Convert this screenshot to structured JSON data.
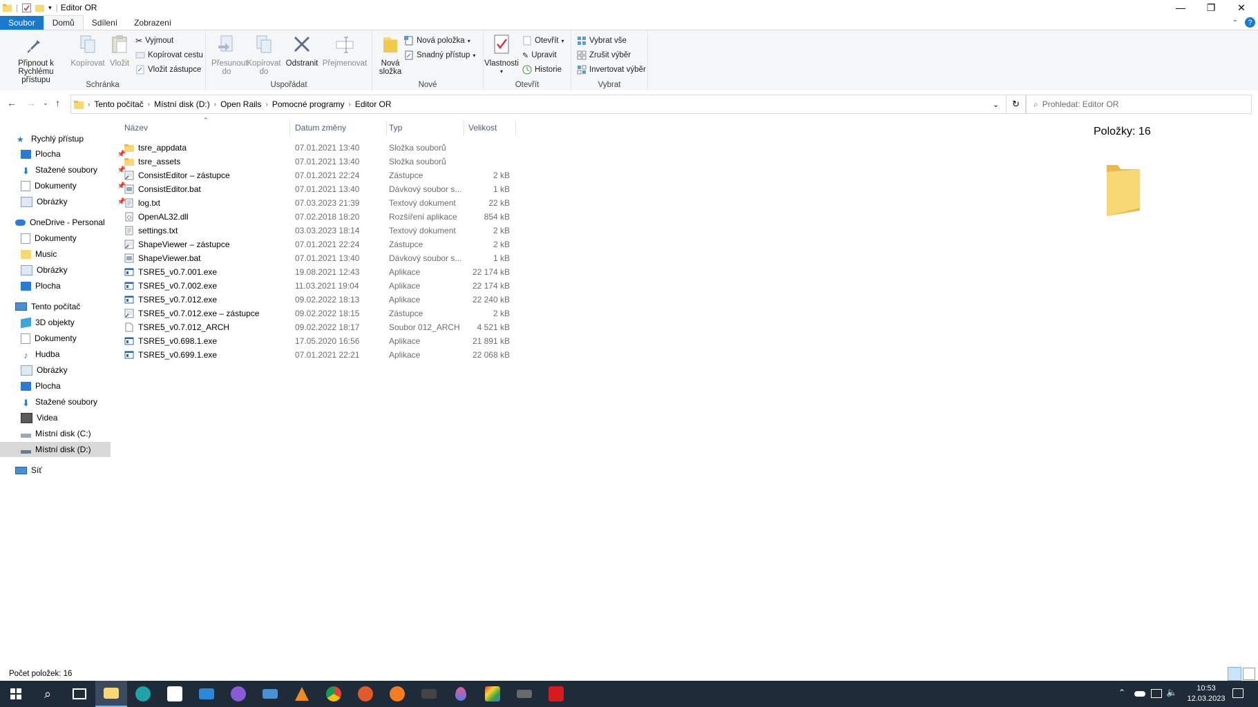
{
  "window": {
    "title": "Editor OR"
  },
  "tabs": [
    "Soubor",
    "Domů",
    "Sdílení",
    "Zobrazení"
  ],
  "ribbon": {
    "pin": "Připnout k Rychlému přístupu",
    "copy": "Kopírovat",
    "paste": "Vložit",
    "cut": "Vyjmout",
    "copy_path": "Kopírovat cestu",
    "paste_shortcut": "Vložit zástupce",
    "clipboard_group": "Schránka",
    "move_to": "Přesunout do",
    "copy_to": "Kopírovat do",
    "delete": "Odstranit",
    "rename": "Přejmenovat",
    "organize_group": "Uspořádat",
    "new_folder": "Nová složka",
    "new_item": "Nová položka",
    "easy_access": "Snadný přístup",
    "new_group": "Nové",
    "properties": "Vlastnosti",
    "open": "Otevřít",
    "edit": "Upravit",
    "history": "Historie",
    "open_group": "Otevřít",
    "select_all": "Vybrat vše",
    "select_none": "Zrušit výběr",
    "invert_selection": "Invertovat výběr",
    "select_group": "Vybrat"
  },
  "breadcrumb": [
    "Tento počítač",
    "Místní disk (D:)",
    "Open Rails",
    "Pomocné programy",
    "Editor OR"
  ],
  "search": {
    "placeholder": "Prohledat: Editor OR"
  },
  "nav": {
    "quick_access": "Rychlý přístup",
    "qa_items": [
      "Plocha",
      "Stažené soubory",
      "Dokumenty",
      "Obrázky"
    ],
    "onedrive": "OneDrive - Personal",
    "od_items": [
      "Dokumenty",
      "Music",
      "Obrázky",
      "Plocha"
    ],
    "this_pc": "Tento počítač",
    "pc_items": [
      "3D objekty",
      "Dokumenty",
      "Hudba",
      "Obrázky",
      "Plocha",
      "Stažené soubory",
      "Videa",
      "Místní disk (C:)",
      "Místní disk (D:)"
    ],
    "network": "Síť"
  },
  "columns": {
    "name": "Název",
    "date": "Datum změny",
    "type": "Typ",
    "size": "Velikost"
  },
  "files": [
    {
      "name": "tsre_appdata",
      "date": "07.01.2021 13:40",
      "type": "Složka souborů",
      "size": "",
      "icon": "folder"
    },
    {
      "name": "tsre_assets",
      "date": "07.01.2021 13:40",
      "type": "Složka souborů",
      "size": "",
      "icon": "folder"
    },
    {
      "name": "ConsistEditor – zástupce",
      "date": "07.01.2021 22:24",
      "type": "Zástupce",
      "size": "2 kB",
      "icon": "shortcut"
    },
    {
      "name": "ConsistEditor.bat",
      "date": "07.01.2021 13:40",
      "type": "Dávkový soubor s...",
      "size": "1 kB",
      "icon": "bat"
    },
    {
      "name": "log.txt",
      "date": "07.03.2023 21:39",
      "type": "Textový dokument",
      "size": "22 kB",
      "icon": "txt"
    },
    {
      "name": "OpenAL32.dll",
      "date": "07.02.2018 18:20",
      "type": "Rozšíření aplikace",
      "size": "854 kB",
      "icon": "dll"
    },
    {
      "name": "settings.txt",
      "date": "03.03.2023 18:14",
      "type": "Textový dokument",
      "size": "2 kB",
      "icon": "txt"
    },
    {
      "name": "ShapeViewer – zástupce",
      "date": "07.01.2021 22:24",
      "type": "Zástupce",
      "size": "2 kB",
      "icon": "shortcut"
    },
    {
      "name": "ShapeViewer.bat",
      "date": "07.01.2021 13:40",
      "type": "Dávkový soubor s...",
      "size": "1 kB",
      "icon": "bat"
    },
    {
      "name": "TSRE5_v0.7.001.exe",
      "date": "19.08.2021 12:43",
      "type": "Aplikace",
      "size": "22 174 kB",
      "icon": "exe"
    },
    {
      "name": "TSRE5_v0.7.002.exe",
      "date": "11.03.2021 19:04",
      "type": "Aplikace",
      "size": "22 174 kB",
      "icon": "exe"
    },
    {
      "name": "TSRE5_v0.7.012.exe",
      "date": "09.02.2022 18:13",
      "type": "Aplikace",
      "size": "22 240 kB",
      "icon": "exe"
    },
    {
      "name": "TSRE5_v0.7.012.exe – zástupce",
      "date": "09.02.2022 18:15",
      "type": "Zástupce",
      "size": "2 kB",
      "icon": "shortcut"
    },
    {
      "name": "TSRE5_v0.7.012_ARCH",
      "date": "09.02.2022 18:17",
      "type": "Soubor 012_ARCH",
      "size": "4 521 kB",
      "icon": "file"
    },
    {
      "name": "TSRE5_v0.698.1.exe",
      "date": "17.05.2020 16:56",
      "type": "Aplikace",
      "size": "21 891 kB",
      "icon": "exe"
    },
    {
      "name": "TSRE5_v0.699.1.exe",
      "date": "07.01.2021 22:21",
      "type": "Aplikace",
      "size": "22 068 kB",
      "icon": "exe"
    }
  ],
  "preview": {
    "items_label": "Položky: 16"
  },
  "status": {
    "count": "Počet položek: 16"
  },
  "clock": {
    "time": "10:53",
    "date": "12.03.2023"
  },
  "colors": {
    "accent": "#1979ca",
    "folder": "#f8d775",
    "taskbar": "#1f2b38",
    "selected": "#d9d9d9"
  }
}
